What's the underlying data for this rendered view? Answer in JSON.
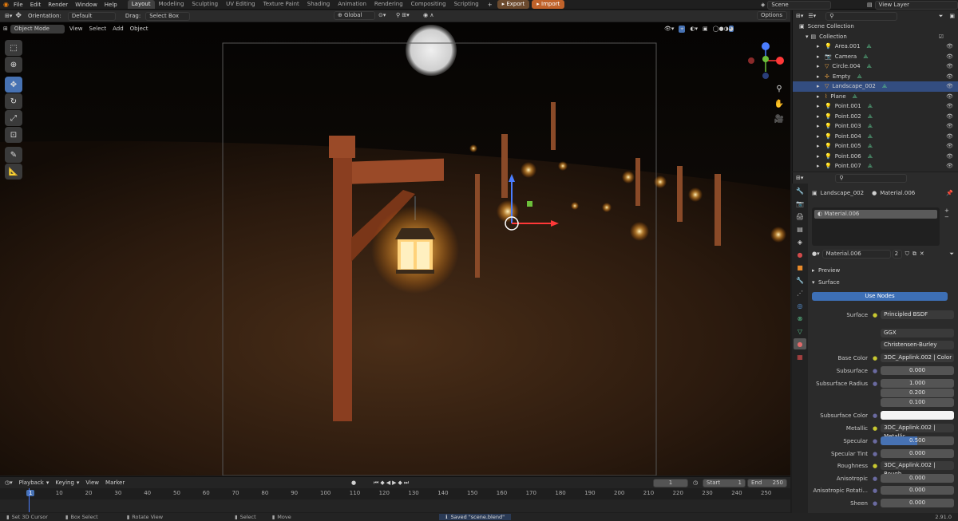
{
  "menu": [
    "File",
    "Edit",
    "Render",
    "Window",
    "Help"
  ],
  "workspaces": [
    "Layout",
    "Modeling",
    "Sculpting",
    "UV Editing",
    "Texture Paint",
    "Shading",
    "Animation",
    "Rendering",
    "Compositing",
    "Scripting"
  ],
  "export_label": "Export",
  "import_label": "Import",
  "scene_label": "Scene",
  "view_layer_label": "View Layer",
  "header": {
    "orientation_label": "Orientation:",
    "orientation_value": "Default",
    "drag_label": "Drag:",
    "drag_value": "Select Box",
    "global": "Global",
    "options": "Options"
  },
  "viewport_header": {
    "mode": "Object Mode",
    "items": [
      "View",
      "Select",
      "Add",
      "Object"
    ]
  },
  "outliner": {
    "title": "Scene Collection",
    "collection": "Collection",
    "items": [
      "Area.001",
      "Camera",
      "Circle.004",
      "Empty",
      "Landscape_002",
      "Plane",
      "Point.001",
      "Point.002",
      "Point.003",
      "Point.004",
      "Point.005",
      "Point.006",
      "Point.007"
    ]
  },
  "properties": {
    "object_name": "Landscape_002",
    "material_name": "Material.006",
    "slot_name": "Material.006",
    "datablock_name": "Material.006",
    "user_count": "2",
    "preview_label": "Preview",
    "surface_label": "Surface",
    "use_nodes": "Use Nodes",
    "rows": [
      {
        "label": "Surface",
        "value": "Principled BSDF"
      },
      {
        "label": "",
        "value": "GGX"
      },
      {
        "label": "",
        "value": "Christensen-Burley"
      },
      {
        "label": "Base Color",
        "value": "3DC_Applink.002 | Color"
      },
      {
        "label": "Subsurface",
        "value": "0.000"
      },
      {
        "label": "Subsurface Radius",
        "value": "1.000"
      },
      {
        "label": "",
        "value": "0.200"
      },
      {
        "label": "",
        "value": "0.100"
      },
      {
        "label": "Subsurface Color",
        "value": ""
      },
      {
        "label": "Metallic",
        "value": "3DC_Applink.002 | Metallic"
      },
      {
        "label": "Specular",
        "value": "0.500"
      },
      {
        "label": "Specular Tint",
        "value": "0.000"
      },
      {
        "label": "Roughness",
        "value": "3DC_Applink.002 | Rough..."
      },
      {
        "label": "Anisotropic",
        "value": "0.000"
      },
      {
        "label": "Anisotropic Rotati...",
        "value": "0.000"
      },
      {
        "label": "Sheen",
        "value": "0.000"
      }
    ]
  },
  "timeline": {
    "playback": "Playback",
    "keying": "Keying",
    "view": "View",
    "marker": "Marker",
    "current_frame": "1",
    "start_label": "Start",
    "start_value": "1",
    "end_label": "End",
    "end_value": "250",
    "ticks": [
      "1",
      "10",
      "20",
      "30",
      "40",
      "50",
      "60",
      "70",
      "80",
      "90",
      "100",
      "110",
      "120",
      "130",
      "140",
      "150",
      "160",
      "170",
      "180",
      "190",
      "200",
      "210",
      "220",
      "230",
      "240",
      "250"
    ]
  },
  "status": {
    "cursor": "Set 3D Cursor",
    "box": "Box Select",
    "rotate": "Rotate View",
    "select": "Select",
    "move": "Move",
    "saved": "Saved \"scene.blend\"",
    "version": "2.91.0"
  }
}
